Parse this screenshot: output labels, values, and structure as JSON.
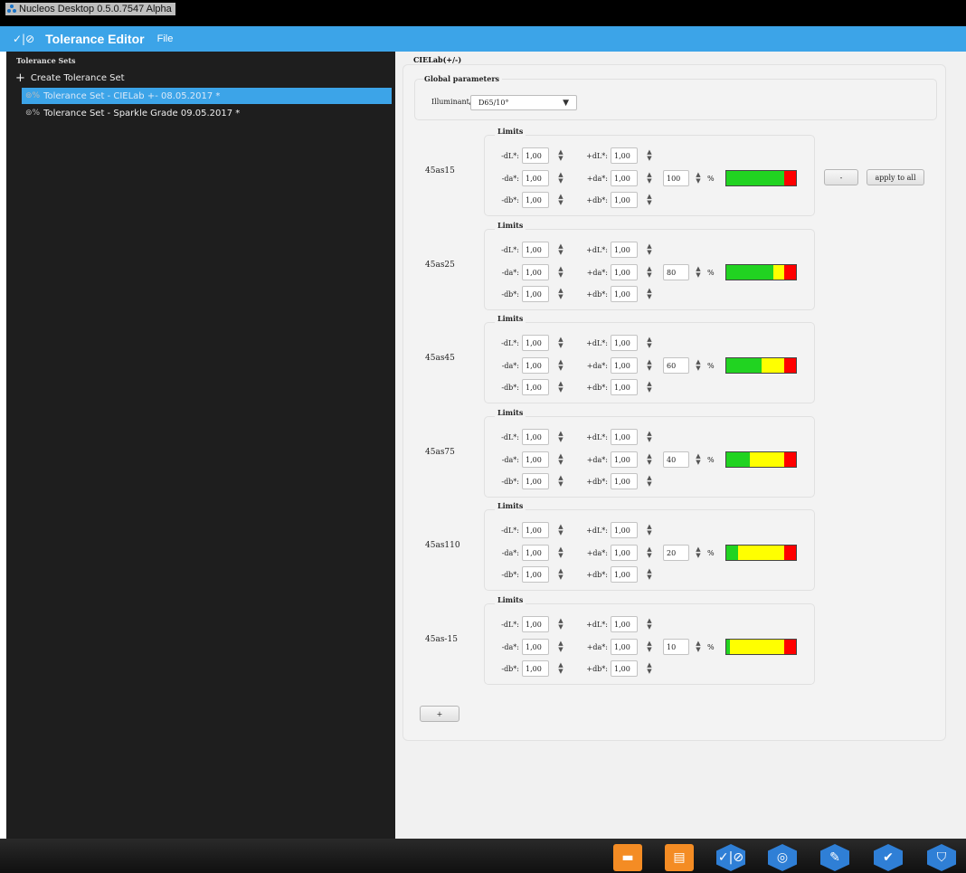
{
  "window": {
    "title": "Nucleos Desktop  0.5.0.7547 Alpha"
  },
  "menubar": {
    "logo": "✓|⊘",
    "app_title": "Tolerance Editor",
    "file_menu": "File"
  },
  "sidebar": {
    "header": "Tolerance Sets",
    "create_label": "Create Tolerance Set",
    "items": [
      {
        "label": "Tolerance Set - CIELab +- 08.05.2017 *",
        "selected": true
      },
      {
        "label": "Tolerance Set - Sparkle Grade 09.05.2017 *",
        "selected": false
      }
    ]
  },
  "main": {
    "title": "CIELab(+/-)",
    "global_title": "Global parameters",
    "illuminant_label": "Illuminant/Observer:",
    "illuminant_value": "D65/10°",
    "limits_title": "Limits",
    "labels": {
      "mdl": "-dL*:",
      "pdl": "+dL*:",
      "mda": "-da*:",
      "pda": "+da*:",
      "mdb": "-db*:",
      "pdb": "+db*:",
      "pct": "%"
    },
    "groups": [
      {
        "name": "45as15",
        "mdl": "1,00",
        "pdl": "1,00",
        "mda": "1,00",
        "pda": "1,00",
        "mdb": "1,00",
        "pdb": "1,00",
        "percent": "100",
        "bar": {
          "green": 0.83,
          "yellow": 0.0,
          "red": 0.17
        }
      },
      {
        "name": "45as25",
        "mdl": "1,00",
        "pdl": "1,00",
        "mda": "1,00",
        "pda": "1,00",
        "mdb": "1,00",
        "pdb": "1,00",
        "percent": "80",
        "bar": {
          "green": 0.68,
          "yellow": 0.15,
          "red": 0.17
        }
      },
      {
        "name": "45as45",
        "mdl": "1,00",
        "pdl": "1,00",
        "mda": "1,00",
        "pda": "1,00",
        "mdb": "1,00",
        "pdb": "1,00",
        "percent": "60",
        "bar": {
          "green": 0.51,
          "yellow": 0.32,
          "red": 0.17
        }
      },
      {
        "name": "45as75",
        "mdl": "1,00",
        "pdl": "1,00",
        "mda": "1,00",
        "pda": "1,00",
        "mdb": "1,00",
        "pdb": "1,00",
        "percent": "40",
        "bar": {
          "green": 0.34,
          "yellow": 0.49,
          "red": 0.17
        }
      },
      {
        "name": "45as110",
        "mdl": "1,00",
        "pdl": "1,00",
        "mda": "1,00",
        "pda": "1,00",
        "mdb": "1,00",
        "pdb": "1,00",
        "percent": "20",
        "bar": {
          "green": 0.17,
          "yellow": 0.66,
          "red": 0.17
        }
      },
      {
        "name": "45as-15",
        "mdl": "1,00",
        "pdl": "1,00",
        "mda": "1,00",
        "pda": "1,00",
        "mdb": "1,00",
        "pdb": "1,00",
        "percent": "10",
        "bar": {
          "green": 0.06,
          "yellow": 0.77,
          "red": 0.17
        }
      }
    ],
    "minus_button": "-",
    "apply_all_button": "apply to all",
    "add_button": "+"
  },
  "colors": {
    "accent": "#3ca4e8",
    "sidebar_bg": "#1e1e1e",
    "green": "#21d321",
    "yellow": "#ffff00",
    "red": "#ff0000",
    "taskbar_orange": "#f48c24",
    "taskbar_blue": "#2f7fd6"
  },
  "taskbar": {
    "icons": [
      {
        "name": "folder-icon",
        "glyph": "▬",
        "style": "orange"
      },
      {
        "name": "clipboard-icon",
        "glyph": "▤",
        "style": "orange"
      },
      {
        "name": "tolerance-editor-icon",
        "glyph": "✓|⊘",
        "style": "blue"
      },
      {
        "name": "measure-target-icon",
        "glyph": "◎",
        "style": "blue"
      },
      {
        "name": "instrument-icon",
        "glyph": "✎",
        "style": "blue"
      },
      {
        "name": "check-icon",
        "glyph": "✔",
        "style": "blue"
      },
      {
        "name": "shield-check-icon",
        "glyph": "⛉",
        "style": "blue"
      }
    ]
  }
}
